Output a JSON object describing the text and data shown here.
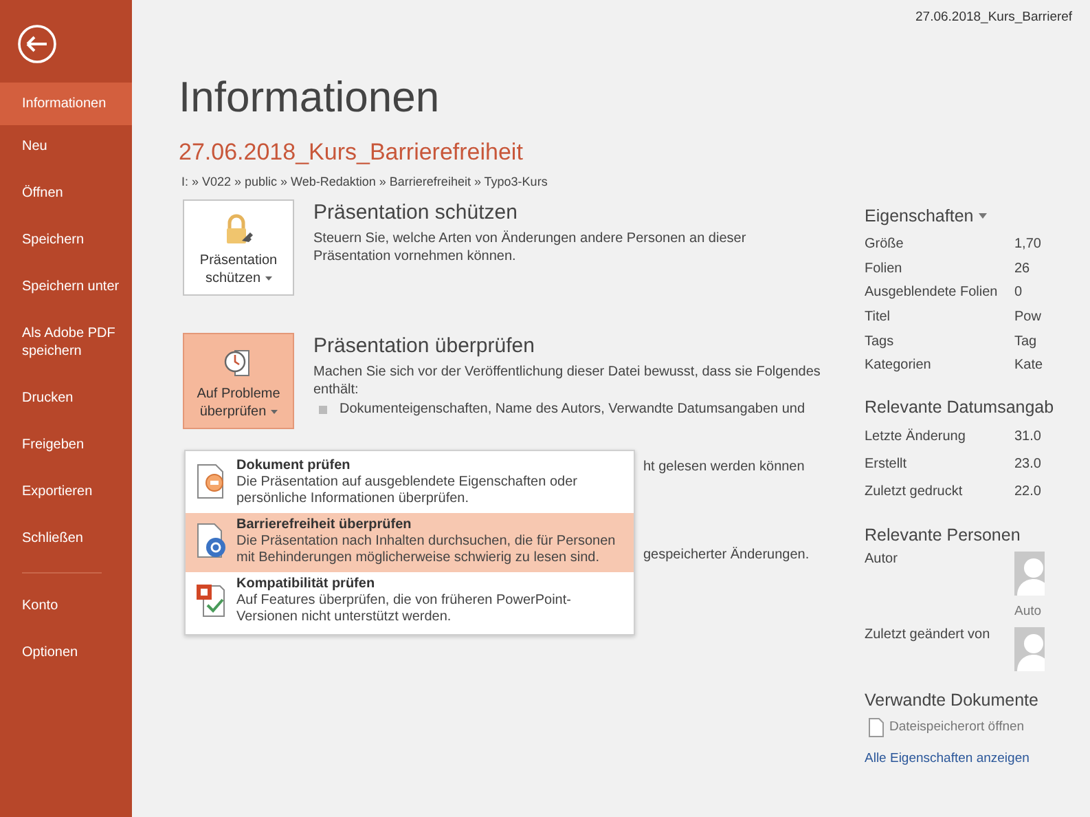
{
  "window": {
    "title": "27.06.2018_Kurs_Barrieref"
  },
  "sidebar": {
    "items": [
      {
        "label": "Informationen",
        "selected": true
      },
      {
        "label": "Neu",
        "selected": false
      },
      {
        "label": "Öffnen",
        "selected": false
      },
      {
        "label": "Speichern",
        "selected": false
      },
      {
        "label": "Speichern unter",
        "selected": false
      },
      {
        "label": "Als Adobe PDF speichern",
        "selected": false
      },
      {
        "label": "Drucken",
        "selected": false
      },
      {
        "label": "Freigeben",
        "selected": false
      },
      {
        "label": "Exportieren",
        "selected": false
      },
      {
        "label": "Schließen",
        "selected": false
      }
    ],
    "bottom_items": [
      {
        "label": "Konto",
        "selected": false
      },
      {
        "label": "Optionen",
        "selected": false
      }
    ]
  },
  "page": {
    "heading": "Informationen",
    "file_name": "27.06.2018_Kurs_Barrierefreiheit",
    "path": "I: » V022 » public » Web-Redaktion » Barrierefreiheit » Typo3-Kurs"
  },
  "sections": [
    {
      "kind": "protect",
      "button": "Präsentation schützen",
      "highlighted": false,
      "title": "Präsentation schützen",
      "description": "Steuern Sie, welche Arten von Änderungen andere Personen an dieser Präsentation vornehmen können."
    },
    {
      "kind": "inspect",
      "button": "Auf Probleme überprüfen",
      "highlighted": true,
      "title": "Präsentation überprüfen",
      "description": "Machen Sie sich vor der Veröffentlichung dieser Datei bewusst, dass sie Folgendes enthält:",
      "bullet": "Dokumenteigenschaften, Name des Autors, Verwandte Datumsangaben und",
      "fragments": [
        "ht gelesen werden können",
        "gespeicherter Änderungen."
      ]
    }
  ],
  "dropdown_menu": [
    {
      "kind": "document",
      "title": "Dokument prüfen",
      "description": "Die Präsentation auf ausgeblendete Eigenschaften oder persönliche Informationen überprüfen.",
      "selected": false
    },
    {
      "kind": "accessibility",
      "title": "Barrierefreiheit überprüfen",
      "description": "Die Präsentation nach Inhalten durchsuchen, die für Personen mit Behinderungen möglicherweise schwierig zu lesen sind.",
      "selected": true
    },
    {
      "kind": "compatibility",
      "title": "Kompatibilität prüfen",
      "description": "Auf Features überprüfen, die von früheren PowerPoint-Versionen nicht unterstützt werden.",
      "selected": false
    }
  ],
  "properties": {
    "heading": "Eigenschaften",
    "rows": [
      {
        "label": "Größe",
        "value": "1,70"
      },
      {
        "label": "Folien",
        "value": "26"
      },
      {
        "label": "Ausgeblendete Folien",
        "value": "0"
      },
      {
        "label": "Titel",
        "value": "Pow"
      },
      {
        "label": "Tags",
        "value": "Tag"
      },
      {
        "label": "Kategorien",
        "value": "Kate"
      }
    ]
  },
  "dates": {
    "heading": "Relevante Datumsangab",
    "rows": [
      {
        "label": "Letzte Änderung",
        "value": "31.0"
      },
      {
        "label": "Erstellt",
        "value": "23.0"
      },
      {
        "label": "Zuletzt gedruckt",
        "value": "22.0"
      }
    ]
  },
  "people": {
    "heading": "Relevante Personen",
    "rows": [
      {
        "label": "Autor",
        "name": "Auto"
      },
      {
        "label": "Zuletzt geändert von"
      }
    ]
  },
  "related": {
    "heading": "Verwandte Dokumente",
    "open_location": "Dateispeicherort öffnen",
    "all_properties": "Alle Eigenschaften anzeigen"
  }
}
